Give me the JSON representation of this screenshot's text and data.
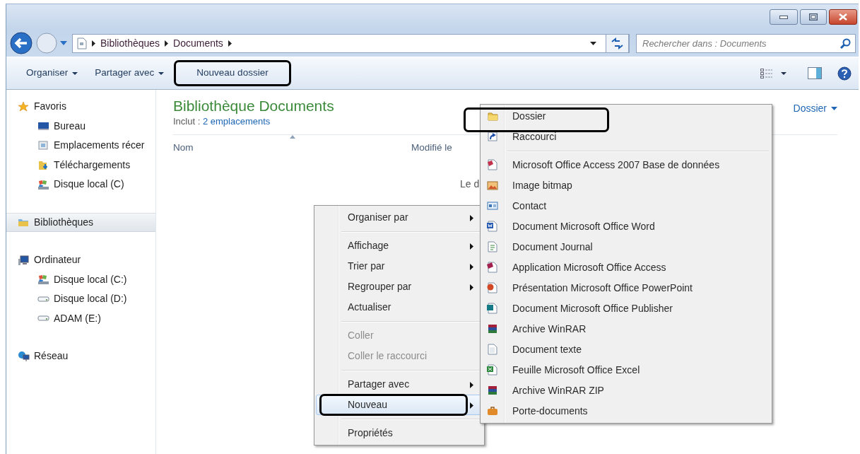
{
  "address_bar": {
    "breadcrumbs": [
      "Bibliothèques",
      "Documents"
    ]
  },
  "search": {
    "placeholder": "Rechercher dans : Documents"
  },
  "toolbar": {
    "items": [
      {
        "label": "Organiser",
        "dropdown": true,
        "annotated": false
      },
      {
        "label": "Partager avec",
        "dropdown": true,
        "annotated": false
      },
      {
        "label": "Nouveau dossier",
        "dropdown": false,
        "annotated": true
      }
    ]
  },
  "sidebar": {
    "items": [
      {
        "label": "Favoris",
        "kind": "star",
        "selected": false,
        "children": [
          {
            "label": "Bureau",
            "kind": "desktop",
            "selected": false
          },
          {
            "label": "Emplacements récer",
            "kind": "recent",
            "selected": false
          },
          {
            "label": "Téléchargements",
            "kind": "downloads",
            "selected": false
          },
          {
            "label": "Disque local (C)",
            "kind": "system-drive",
            "selected": false
          }
        ]
      },
      {
        "label": "Bibliothèques",
        "kind": "library",
        "selected": true
      },
      {
        "label": "Ordinateur",
        "kind": "computer",
        "selected": false,
        "children": [
          {
            "label": "Disque local (C:)",
            "kind": "system-drive",
            "selected": false
          },
          {
            "label": "Disque local (D:)",
            "kind": "drive",
            "selected": false
          },
          {
            "label": "ADAM (E:)",
            "kind": "drive",
            "selected": false
          }
        ]
      },
      {
        "label": "Réseau",
        "kind": "network",
        "selected": false
      }
    ]
  },
  "library": {
    "title": "Bibliothèque Documents",
    "includes_label": "Inclut :",
    "includes_link": "2 emplacements",
    "arrange_value": "Dossier",
    "columns": [
      {
        "label": "Nom",
        "sorted": true
      },
      {
        "label": "Modifié le",
        "sorted": false
      }
    ],
    "empty_message": "Le d"
  },
  "context_menu": {
    "groups": [
      [
        {
          "label": "Organiser par",
          "submenu": true,
          "disabled": false,
          "highlighted": false,
          "annotated": false
        }
      ],
      [
        {
          "label": "Affichage",
          "submenu": true,
          "disabled": false,
          "highlighted": false,
          "annotated": false
        },
        {
          "label": "Trier par",
          "submenu": true,
          "disabled": false,
          "highlighted": false,
          "annotated": false
        },
        {
          "label": "Regrouper par",
          "submenu": true,
          "disabled": false,
          "highlighted": false,
          "annotated": false
        },
        {
          "label": "Actualiser",
          "submenu": false,
          "disabled": false,
          "highlighted": false,
          "annotated": false
        }
      ],
      [
        {
          "label": "Coller",
          "submenu": false,
          "disabled": true,
          "highlighted": false,
          "annotated": false
        },
        {
          "label": "Coller le raccourci",
          "submenu": false,
          "disabled": true,
          "highlighted": false,
          "annotated": false
        }
      ],
      [
        {
          "label": "Partager avec",
          "submenu": true,
          "disabled": false,
          "highlighted": false,
          "annotated": false
        },
        {
          "label": "Nouveau",
          "submenu": true,
          "disabled": false,
          "highlighted": true,
          "annotated": true
        }
      ],
      [
        {
          "label": "Propriétés",
          "submenu": false,
          "disabled": false,
          "highlighted": false,
          "annotated": false
        }
      ]
    ]
  },
  "submenu": {
    "groups": [
      [
        {
          "label": "Dossier",
          "kind": "folder",
          "annotated": true
        },
        {
          "label": "Raccourci",
          "kind": "shortcut",
          "annotated": false
        }
      ],
      [
        {
          "label": "Microsoft Office Access 2007 Base de données",
          "kind": "database",
          "annotated": false
        },
        {
          "label": "Image bitmap",
          "kind": "bitmap",
          "annotated": false
        },
        {
          "label": "Contact",
          "kind": "contact",
          "annotated": false
        },
        {
          "label": "Document Microsoft Office Word",
          "kind": "word",
          "annotated": false
        },
        {
          "label": "Document Journal",
          "kind": "journal",
          "annotated": false
        },
        {
          "label": "Application Microsoft Office Access",
          "kind": "access",
          "annotated": false
        },
        {
          "label": "Présentation Microsoft Office PowerPoint",
          "kind": "powerpoint",
          "annotated": false
        },
        {
          "label": "Document Microsoft Office Publisher",
          "kind": "publisher",
          "annotated": false
        },
        {
          "label": "Archive WinRAR",
          "kind": "archive",
          "annotated": false
        },
        {
          "label": "Document texte",
          "kind": "text",
          "annotated": false
        },
        {
          "label": "Feuille Microsoft Office Excel",
          "kind": "excel",
          "annotated": false
        },
        {
          "label": "Archive WinRAR ZIP",
          "kind": "archive",
          "annotated": false
        },
        {
          "label": "Porte-documents",
          "kind": "briefcase",
          "annotated": false
        }
      ]
    ]
  }
}
